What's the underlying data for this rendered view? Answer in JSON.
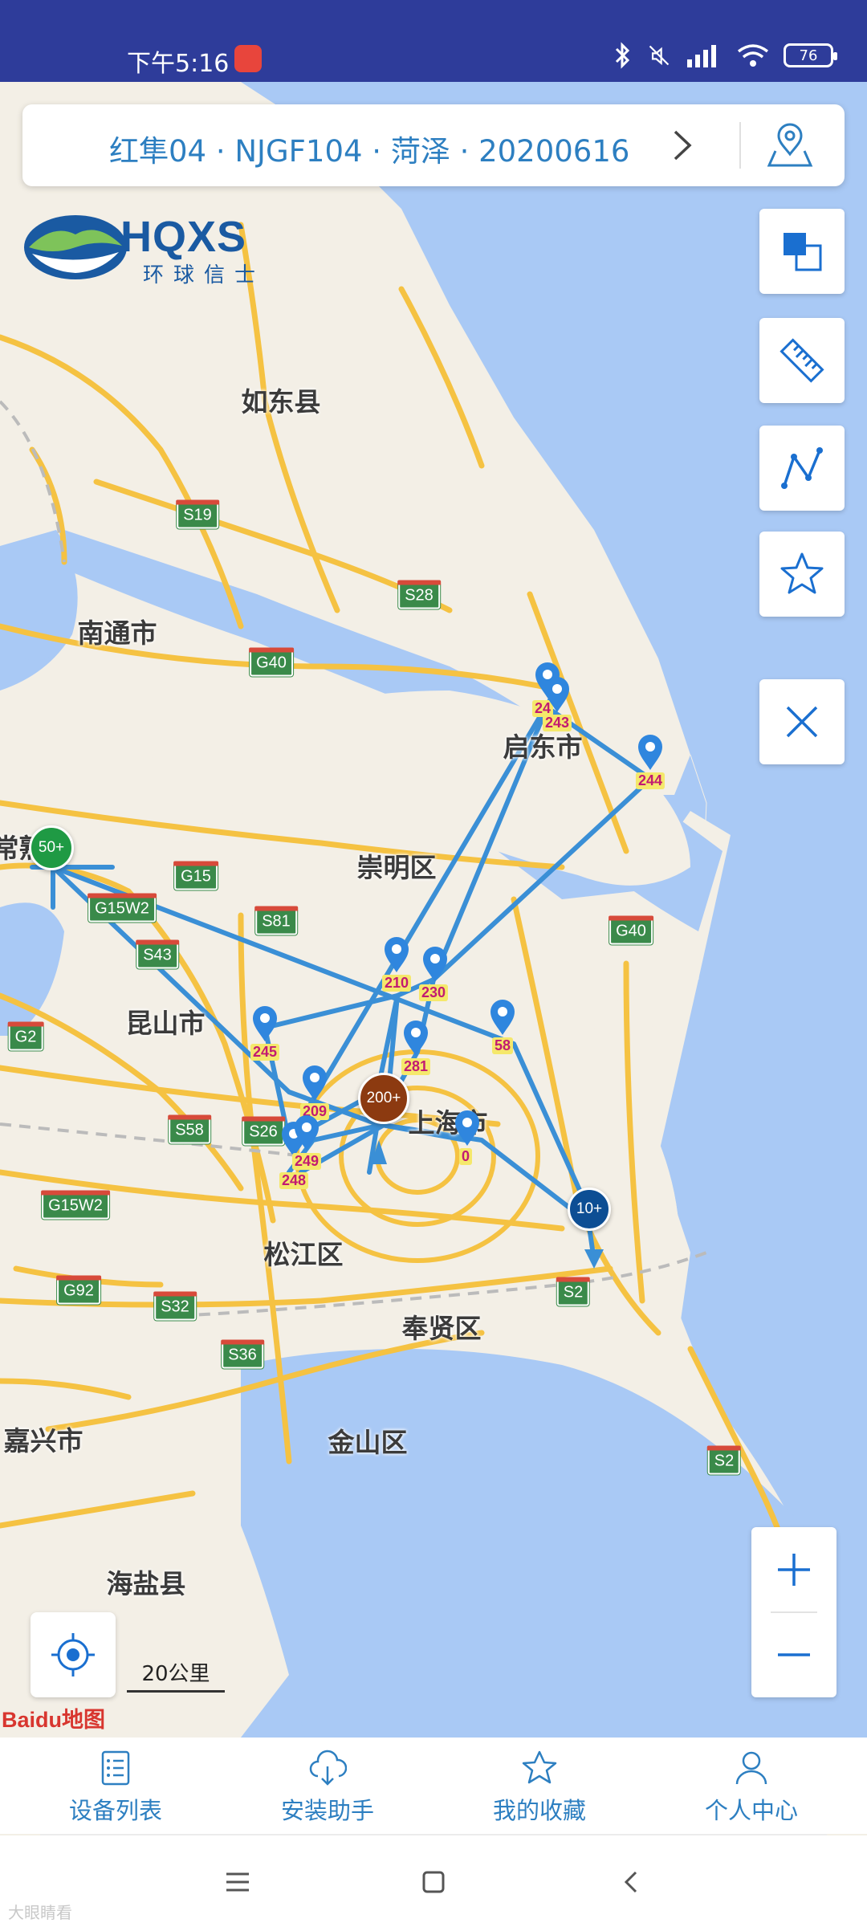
{
  "status_bar": {
    "time": "下午5:16",
    "battery": "76"
  },
  "header": {
    "title": "红隼04 · NJGF104 · 菏泽 · 20200616"
  },
  "logo": {
    "name": "HQXS",
    "subtitle": "环球信士"
  },
  "map": {
    "places": {
      "rudong": "如东县",
      "nantong": "南通市",
      "qidong": "启东市",
      "chongming": "崇明区",
      "changshu": "常熟市",
      "kunshan": "昆山市",
      "shanghai": "上海市",
      "songjiang": "松江区",
      "fengxian": "奉贤区",
      "jinshan": "金山区",
      "jiaxing": "嘉兴市",
      "haiyan": "海盐县"
    },
    "highways": {
      "s19": "S19",
      "s28": "S28",
      "g40a": "G40",
      "g15": "G15",
      "g15w2a": "G15W2",
      "s81": "S81",
      "s43": "S43",
      "g40b": "G40",
      "g2": "G2",
      "s58": "S58",
      "s26": "S26",
      "g15w2b": "G15W2",
      "g92": "G92",
      "s32": "S32",
      "s36": "S36",
      "s2a": "S2",
      "s2b": "S2"
    },
    "pins": {
      "p2x": "24",
      "p243": "243",
      "p244": "244",
      "p210": "210",
      "p230": "230",
      "p245": "245",
      "p281": "281",
      "p58": "58",
      "p209": "209",
      "p0": "0",
      "p249": "249",
      "p24x": "248"
    },
    "clusters": {
      "c50": "50+",
      "c200": "200+",
      "c10": "10+"
    },
    "scale_label": "20公里",
    "attribution": "Baidu地图"
  },
  "bottom_nav": {
    "items": [
      {
        "label": "设备列表",
        "icon": "list-icon"
      },
      {
        "label": "安装助手",
        "icon": "cloud-icon"
      },
      {
        "label": "我的收藏",
        "icon": "star-icon"
      },
      {
        "label": "个人中心",
        "icon": "person-icon"
      }
    ]
  },
  "colors": {
    "status_bar": "#2e3c9a",
    "accent": "#2d7fc1",
    "track": "#3a8fd6",
    "water": "#a8c8f5",
    "land": "#f3efe6",
    "road": "#f5c242"
  },
  "watermark": "大眼睛看"
}
